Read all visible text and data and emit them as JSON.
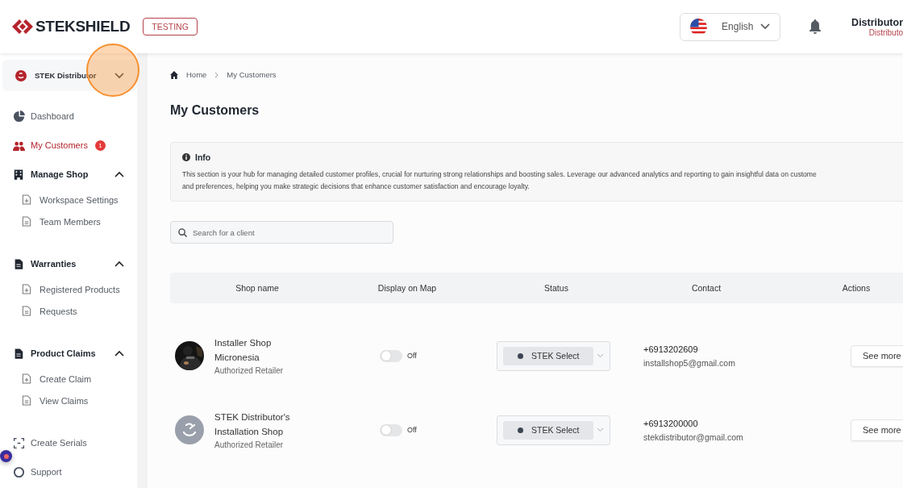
{
  "header": {
    "brand": "STEKSHIELD",
    "env_badge": "TESTING",
    "language": "English",
    "user_name": "Distributor",
    "user_role": "Distributo"
  },
  "sidebar": {
    "account": "STEK Distributor",
    "items": [
      {
        "kind": "link",
        "label": "Dashboard",
        "selected": false
      },
      {
        "kind": "link",
        "label": "My Customers",
        "selected": true,
        "badge": "1"
      },
      {
        "kind": "group",
        "label": "Manage Shop",
        "expanded": true,
        "children": [
          {
            "label": "Workspace Settings"
          },
          {
            "label": "Team Members"
          }
        ]
      },
      {
        "kind": "group",
        "label": "Warranties",
        "expanded": true,
        "children": [
          {
            "label": "Registered Products"
          },
          {
            "label": "Requests"
          }
        ]
      },
      {
        "kind": "group",
        "label": "Product Claims",
        "expanded": true,
        "children": [
          {
            "label": "Create Claim"
          },
          {
            "label": "View Claims"
          }
        ]
      },
      {
        "kind": "link",
        "label": "Create Serials",
        "selected": false
      },
      {
        "kind": "link",
        "label": "Support",
        "selected": false
      }
    ]
  },
  "breadcrumb": [
    "Home",
    "My Customers"
  ],
  "title": "My Customers",
  "info": {
    "heading": "Info",
    "lines": [
      "This section is your hub for managing detailed customer profiles, crucial for nurturing strong relationships and boosting sales. Leverage our advanced analytics and reporting to gain insightful data on custome",
      "and preferences, helping you make strategic decisions that enhance customer satisfaction and encourage loyalty."
    ]
  },
  "search": {
    "placeholder": "Search for a client"
  },
  "table": {
    "columns": [
      "Shop name",
      "Display on Map",
      "Status",
      "Contact",
      "Actions"
    ],
    "rows": [
      {
        "kind": "picture",
        "name": "Installer Shop Micronesia",
        "type": "Authorized Retailer",
        "display_on_map": false,
        "toggle_label": "Off",
        "status": "STEK Select",
        "phone": "+6913202609",
        "email": "installshop5@gmail.com",
        "action": "See more"
      },
      {
        "kind": "logo",
        "name": "STEK Distributor's Installation Shop",
        "type": "Authorized Retailer",
        "display_on_map": false,
        "toggle_label": "Off",
        "status": "STEK Select",
        "phone": "+6913200000",
        "email": "stekdistributor@gmail.com",
        "action": "See more"
      }
    ]
  }
}
